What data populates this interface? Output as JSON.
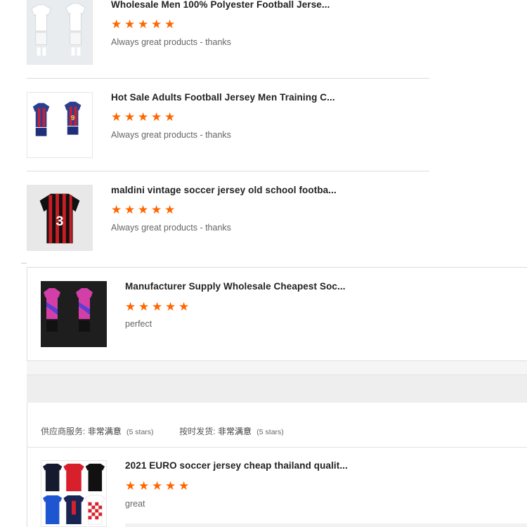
{
  "reviews": [
    {
      "title": "Wholesale Men 100% Polyester Football Jerse...",
      "rating": 5,
      "comment": "Always great products - thanks",
      "thumb_icon": "white-football-kit-image"
    },
    {
      "title": "Hot Sale Adults Football Jersey Men Training C...",
      "rating": 5,
      "comment": "Always great products - thanks",
      "thumb_icon": "blue-red-football-kit-image"
    },
    {
      "title": "maldini vintage soccer jersey old school footba...",
      "rating": 5,
      "comment": "Always great products - thanks",
      "thumb_icon": "red-black-striped-jersey-image"
    },
    {
      "title": "Manufacturer Supply Wholesale Cheapest Soc...",
      "rating": 5,
      "comment": "perfect",
      "thumb_icon": "pink-purple-football-kit-image"
    }
  ],
  "supplier_ratings": {
    "service_label": "供应商服务:",
    "service_value": "非常满意",
    "service_count": "(5 stars)",
    "delivery_label": "按时发货:",
    "delivery_value": "非常满意",
    "delivery_count": "(5 stars)"
  },
  "last_review": {
    "title": "2021 EURO soccer jersey cheap thailand qualit...",
    "rating": 5,
    "comment": "great",
    "thumb_icon": "assorted-jerseys-grid-image"
  },
  "colors": {
    "star": "#ff6600",
    "separator": "#dcdcdc"
  }
}
